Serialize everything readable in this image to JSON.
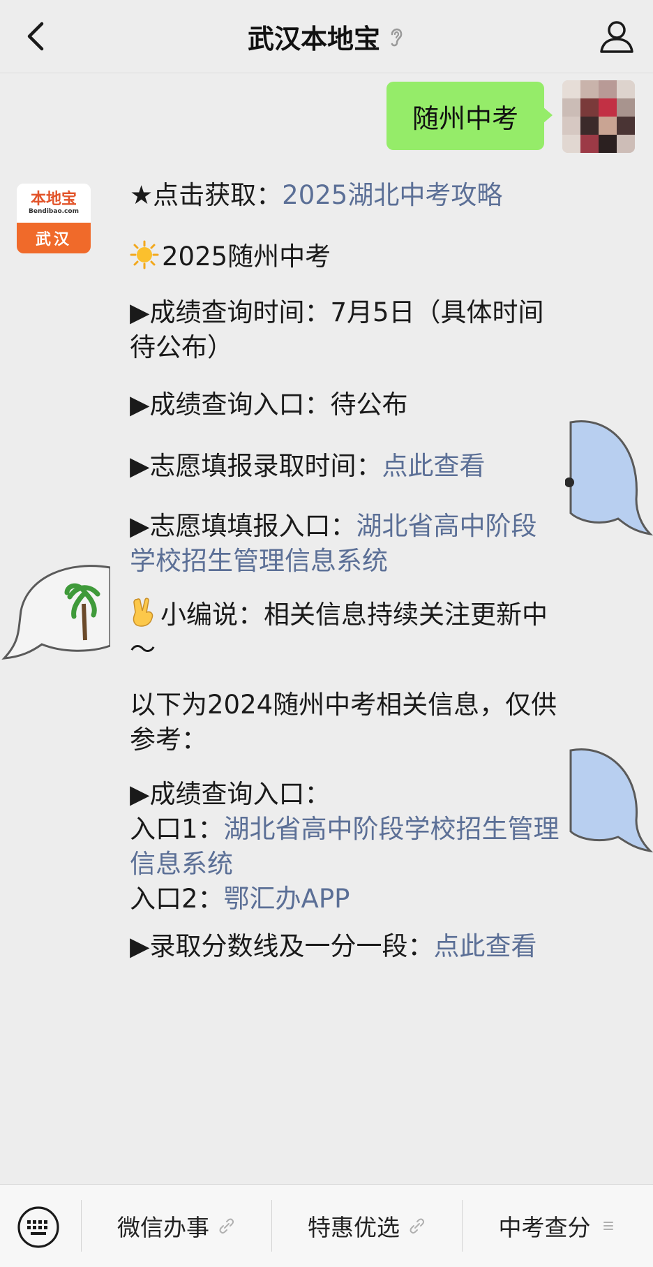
{
  "header": {
    "title": "武汉本地宝"
  },
  "outgoing_message": {
    "text": "随州中考"
  },
  "account_logo": {
    "name": "本地宝",
    "domain": "Bendibao.com",
    "city": "武汉"
  },
  "message": {
    "p1_prefix": "★点击获取：",
    "p1_link": "2025湖北中考攻略",
    "p2_text": "2025随州中考",
    "p3_text": "▶成绩查询时间：7月5日（具体时间待公布）",
    "p4_text": "▶成绩查询入口：待公布",
    "p5_prefix": "▶志愿填报录取时间：",
    "p5_link": "点此查看",
    "p6_prefix": "▶志愿填填报入口：",
    "p6_link": "湖北省高中阶段学校招生管理信息系统",
    "p7_text": "小编说：相关信息持续关注更新中～",
    "p8_text": "以下为2024随州中考相关信息，仅供参考：",
    "p9_line1": "▶成绩查询入口：",
    "p9_entry1_prefix": "入口1：",
    "p9_entry1_link": "湖北省高中阶段学校招生管理信息系统",
    "p9_entry2_prefix": "入口2：",
    "p9_entry2_link": "鄂汇办APP",
    "p10_prefix": "▶录取分数线及一分一段：",
    "p10_link": "点此查看"
  },
  "menu": {
    "items": [
      {
        "label": "微信办事"
      },
      {
        "label": "特惠优选"
      },
      {
        "label": "中考查分"
      }
    ]
  },
  "colors": {
    "link": "#5b6f96",
    "bubble_green": "#95ec69",
    "background": "#ededed",
    "logo_orange": "#f06a2a"
  }
}
